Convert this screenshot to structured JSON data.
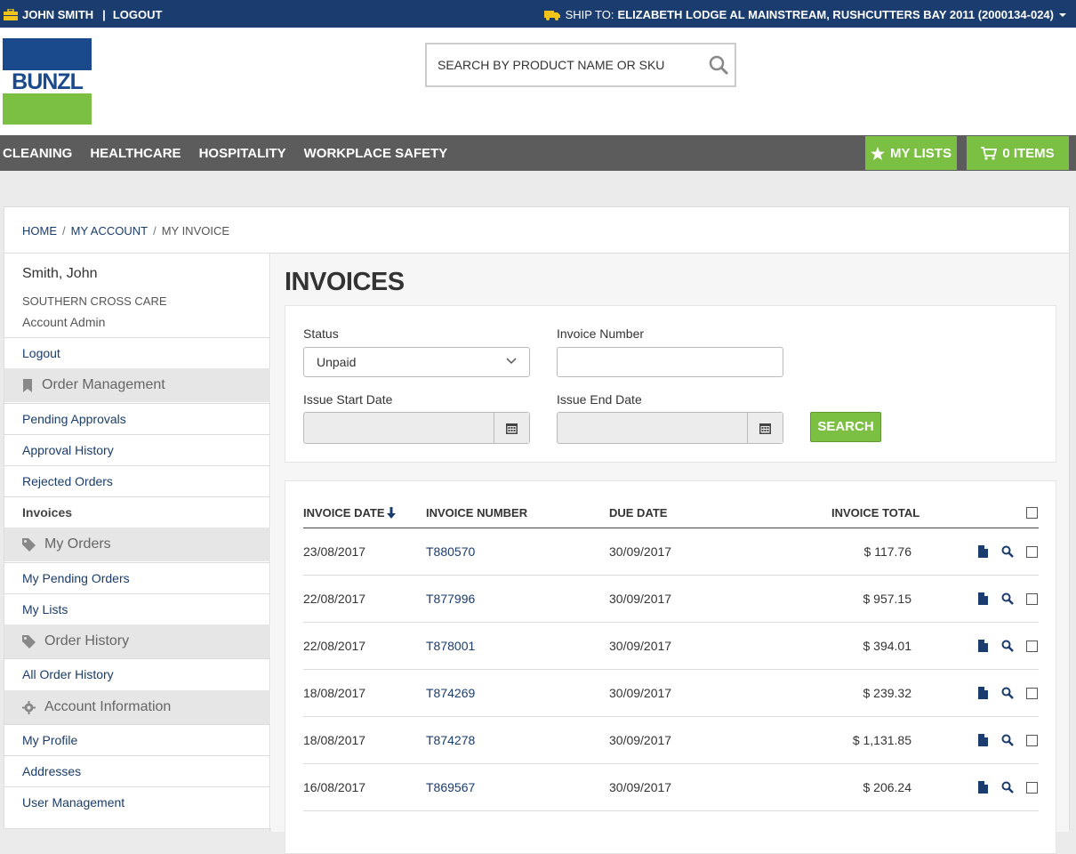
{
  "topbar": {
    "user_name": "JOHN SMITH",
    "separator": "|",
    "logout": "LOGOUT",
    "ship_to_label": "SHIP TO:",
    "ship_to_value": "ELIZABETH LODGE AL MAINSTREAM, RUSHCUTTERS BAY 2011 (2000134-024)"
  },
  "logo": {
    "text": "BUNZL"
  },
  "search": {
    "placeholder": "SEARCH BY PRODUCT NAME OR SKU"
  },
  "nav": {
    "items": [
      "CLEANING",
      "HEALTHCARE",
      "HOSPITALITY",
      "WORKPLACE SAFETY"
    ],
    "my_lists": "MY LISTS",
    "cart": "0 ITEMS"
  },
  "breadcrumb": {
    "home": "HOME",
    "my_account": "MY ACCOUNT",
    "current": "MY INVOICE",
    "separator": "/"
  },
  "sidebar": {
    "name": "Smith, John",
    "company": "SOUTHERN CROSS CARE",
    "role": "Account Admin",
    "logout": "Logout",
    "sections": {
      "order_management": "Order Management",
      "pending_approvals": "Pending Approvals",
      "approval_history": "Approval History",
      "rejected_orders": "Rejected Orders",
      "invoices": "Invoices",
      "my_orders": "My Orders",
      "my_pending_orders": "My Pending Orders",
      "my_lists": "My Lists",
      "order_history": "Order History",
      "all_order_history": "All Order History",
      "account_information": "Account Information",
      "my_profile": "My Profile",
      "addresses": "Addresses",
      "user_management": "User Management"
    }
  },
  "main": {
    "title": "INVOICES",
    "filters": {
      "status_label": "Status",
      "status_value": "Unpaid",
      "invoice_number_label": "Invoice Number",
      "invoice_number_value": "",
      "start_date_label": "Issue Start Date",
      "end_date_label": "Issue End Date",
      "search_button": "SEARCH"
    },
    "table": {
      "columns": [
        "INVOICE DATE",
        "INVOICE NUMBER",
        "DUE DATE",
        "INVOICE TOTAL"
      ],
      "rows": [
        {
          "date": "23/08/2017",
          "number": "T880570",
          "due": "30/09/2017",
          "total": "$ 117.76"
        },
        {
          "date": "22/08/2017",
          "number": "T877996",
          "due": "30/09/2017",
          "total": "$ 957.15"
        },
        {
          "date": "22/08/2017",
          "number": "T878001",
          "due": "30/09/2017",
          "total": "$ 394.01"
        },
        {
          "date": "18/08/2017",
          "number": "T874269",
          "due": "30/09/2017",
          "total": "$ 239.32"
        },
        {
          "date": "18/08/2017",
          "number": "T874278",
          "due": "30/09/2017",
          "total": "$ 1,131.85"
        },
        {
          "date": "16/08/2017",
          "number": "T869567",
          "due": "30/09/2017",
          "total": "$ 206.24"
        }
      ]
    }
  },
  "colors": {
    "topbar": "#1a3c6e",
    "nav": "#5c5c5c",
    "accent_green": "#7bc043",
    "link_blue": "#1a3c6e"
  }
}
